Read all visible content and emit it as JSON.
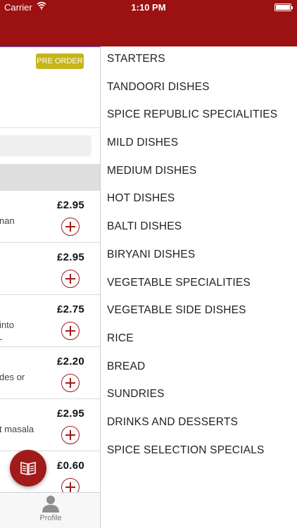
{
  "status_bar": {
    "carrier": "Carrier",
    "time": "1:10 PM",
    "battery": 1.0
  },
  "colors": {
    "brand_red": "#9c1111",
    "preorder_badge": "#c6b518"
  },
  "main": {
    "preorder_label": "PRE ORDER",
    "items": [
      {
        "price": "£2.95",
        "desc": [
          "nan"
        ]
      },
      {
        "price": "£2.95",
        "desc": []
      },
      {
        "price": "£2.75",
        "desc": [
          "into",
          "-"
        ]
      },
      {
        "price": "£2.20",
        "desc": [
          "des or"
        ]
      },
      {
        "price": "£2.95",
        "desc": [
          "t masala"
        ]
      },
      {
        "price": "£0.60",
        "desc": []
      }
    ],
    "fab_icon": "book-icon",
    "tab_profile_label": "Profile",
    "tab_profile_icon": "person-icon"
  },
  "menu": {
    "items": [
      "STARTERS",
      "TANDOORI DISHES",
      "SPICE REPUBLIC SPECIALITIES",
      "MILD DISHES",
      "MEDIUM DISHES",
      "HOT DISHES",
      "BALTI DISHES",
      "BIRYANI DISHES",
      "VEGETABLE SPECIALITIES",
      "VEGETABLE SIDE DISHES",
      "RICE",
      "BREAD",
      "SUNDRIES",
      "DRINKS AND DESSERTS",
      "SPICE SELECTION SPECIALS"
    ]
  }
}
